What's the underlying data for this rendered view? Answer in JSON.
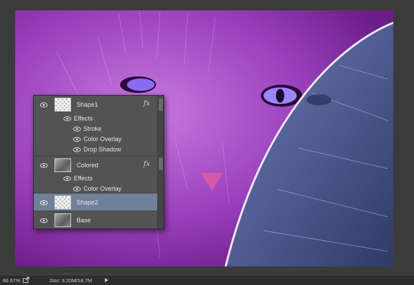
{
  "layers_panel": {
    "layers": [
      {
        "name": "Shape1",
        "fx": "fx",
        "effects_label": "Effects",
        "effects": [
          "Stroke",
          "Color Overlay",
          "Drop Shadow"
        ]
      },
      {
        "name": "Colored",
        "fx": "fx",
        "effects_label": "Effects",
        "effects": [
          "Color Overlay"
        ]
      },
      {
        "name": "Shape2",
        "selected": true
      },
      {
        "name": "Base"
      }
    ]
  },
  "status_bar": {
    "zoom": "66.67%",
    "doc_info": "Doc: 3.20M/18.7M"
  },
  "colors": {
    "selection": "#6f8198",
    "panel": "#535353",
    "canvas_purple": "#9b3fb9",
    "canvas_blue": "#4a5a8c"
  },
  "icons": [
    "eye-icon",
    "fx-icon",
    "share-icon",
    "arrow-right-icon"
  ]
}
